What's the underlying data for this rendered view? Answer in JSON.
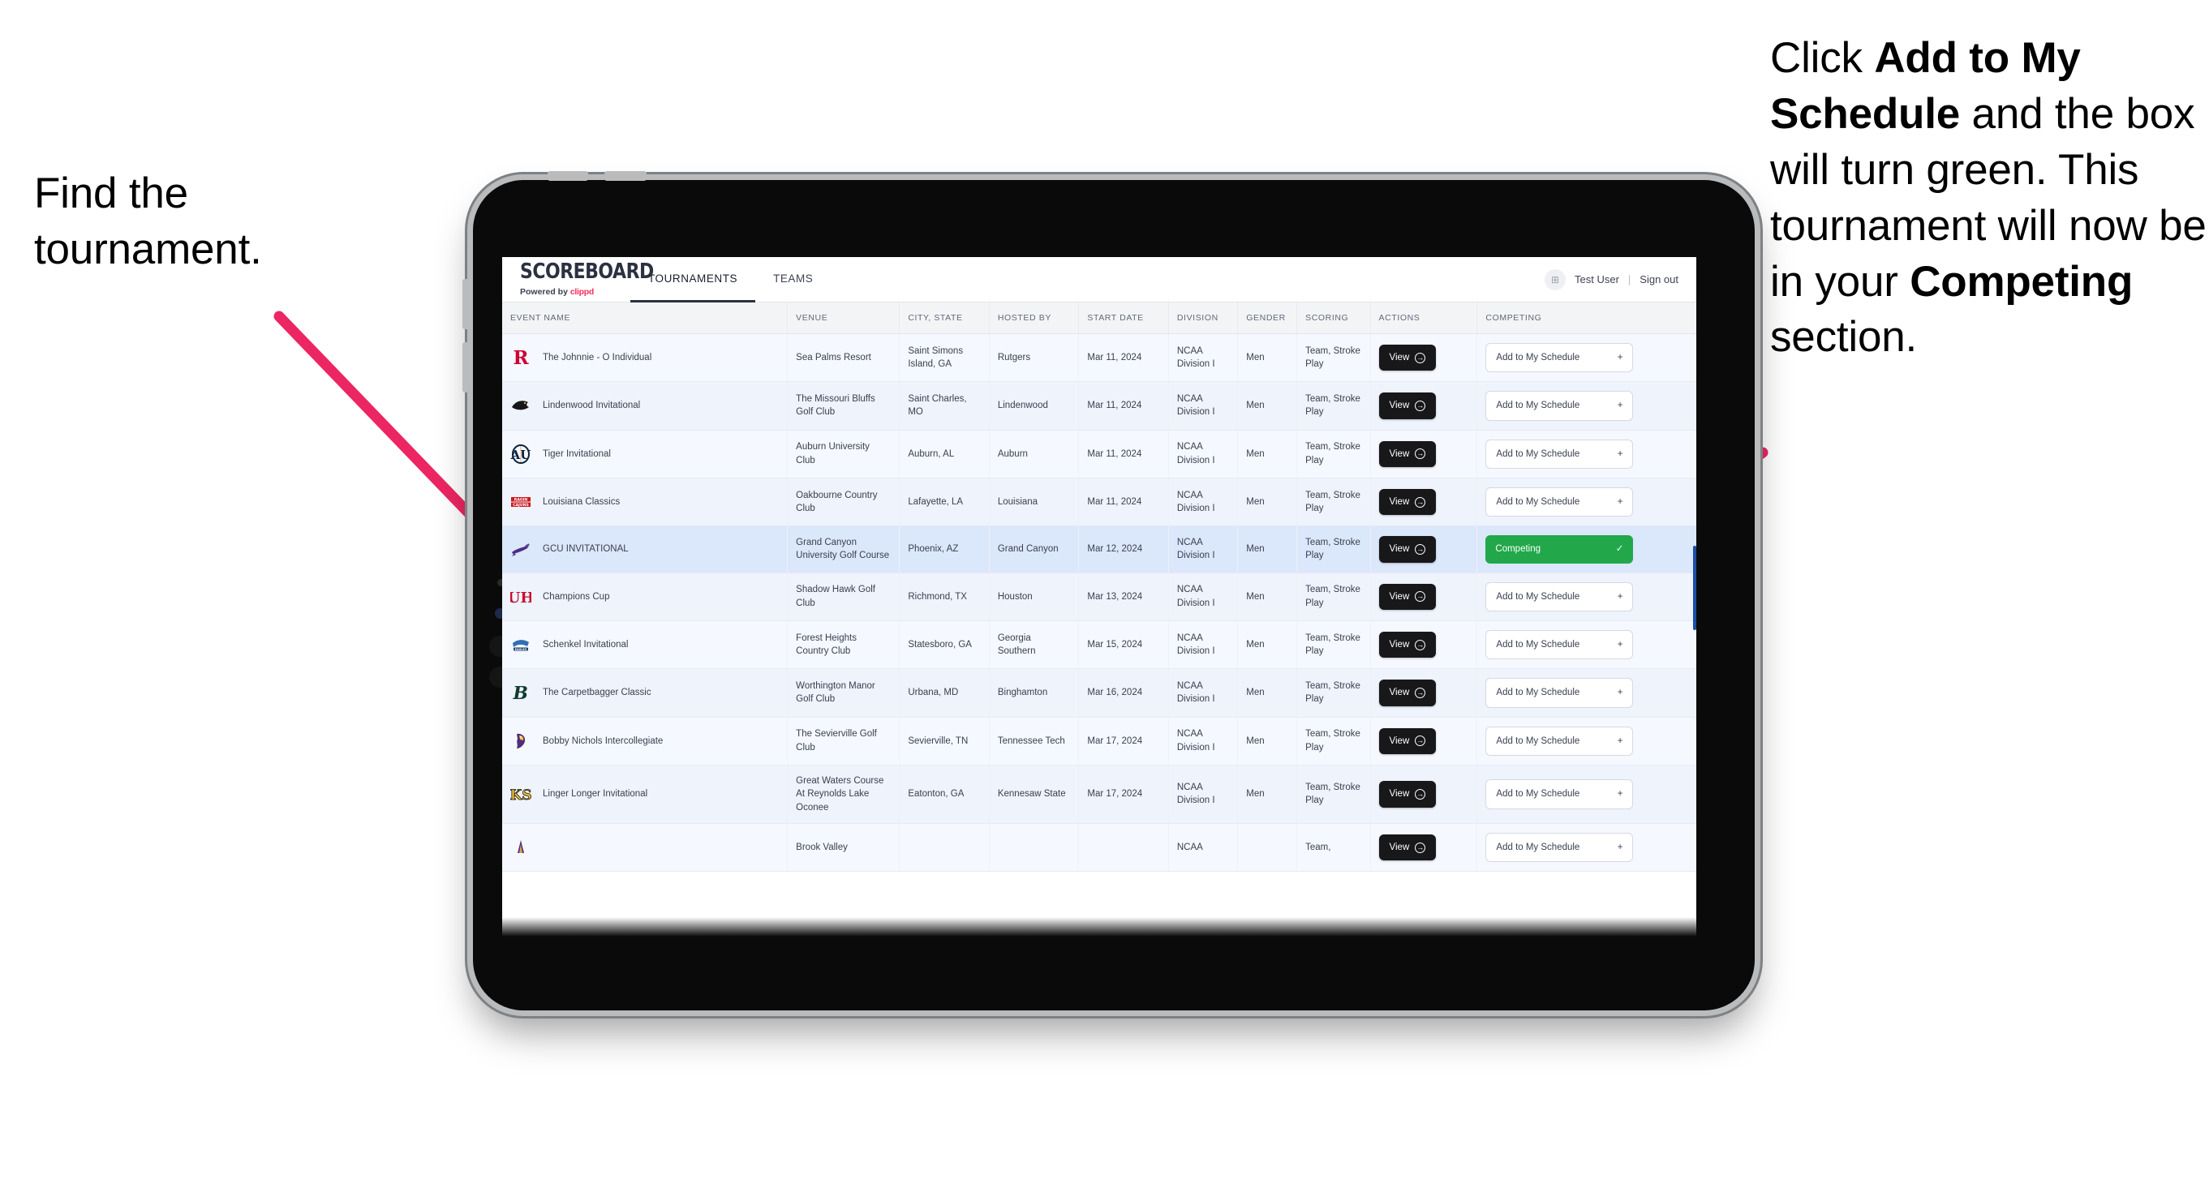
{
  "annotations": {
    "left": "Find the tournament.",
    "right_parts": [
      {
        "text": "Click ",
        "bold": false
      },
      {
        "text": "Add to My Schedule",
        "bold": true
      },
      {
        "text": " and the box will turn green. This tournament will now be in your ",
        "bold": false
      },
      {
        "text": "Competing",
        "bold": true
      },
      {
        "text": " section.",
        "bold": false
      }
    ],
    "arrow_color": "#ec2663"
  },
  "app": {
    "brand": {
      "wordmark": "SCOREBOARD",
      "powered_prefix": "Powered by ",
      "powered_brand": "clippd"
    },
    "tabs": [
      {
        "label": "TOURNAMENTS",
        "active": true
      },
      {
        "label": "TEAMS",
        "active": false
      }
    ],
    "user": {
      "name": "Test User",
      "separator": "|",
      "sign_out": "Sign out",
      "avatar_glyph": "⊞"
    },
    "table": {
      "columns": [
        "EVENT NAME",
        "VENUE",
        "CITY, STATE",
        "HOSTED BY",
        "START DATE",
        "DIVISION",
        "GENDER",
        "SCORING",
        "ACTIONS",
        "COMPETING"
      ],
      "view_label": "View",
      "add_label": "Add to My Schedule",
      "add_glyph": "+",
      "competing_label": "Competing",
      "competing_glyph": "✓",
      "competing_color": "#22a84a",
      "rows": [
        {
          "event": "The Johnnie - O Individual",
          "venue": "Sea Palms Resort",
          "city": "Saint Simons Island, GA",
          "host": "Rutgers",
          "date": "Mar 11, 2024",
          "division": "NCAA Division I",
          "gender": "Men",
          "scoring": "Team, Stroke Play",
          "competing": false,
          "logo": "rutgers-r-logo"
        },
        {
          "event": "Lindenwood Invitational",
          "venue": "The Missouri Bluffs Golf Club",
          "city": "Saint Charles, MO",
          "host": "Lindenwood",
          "date": "Mar 11, 2024",
          "division": "NCAA Division I",
          "gender": "Men",
          "scoring": "Team, Stroke Play",
          "competing": false,
          "logo": "lindenwood-lion-logo"
        },
        {
          "event": "Tiger Invitational",
          "venue": "Auburn University Club",
          "city": "Auburn, AL",
          "host": "Auburn",
          "date": "Mar 11, 2024",
          "division": "NCAA Division I",
          "gender": "Men",
          "scoring": "Team, Stroke Play",
          "competing": false,
          "logo": "auburn-au-logo"
        },
        {
          "event": "Louisiana Classics",
          "venue": "Oakbourne Country Club",
          "city": "Lafayette, LA",
          "host": "Louisiana",
          "date": "Mar 11, 2024",
          "division": "NCAA Division I",
          "gender": "Men",
          "scoring": "Team, Stroke Play",
          "competing": false,
          "logo": "ragin-cajuns-logo"
        },
        {
          "event": "GCU INVITATIONAL",
          "venue": "Grand Canyon University Golf Course",
          "city": "Phoenix, AZ",
          "host": "Grand Canyon",
          "date": "Mar 12, 2024",
          "division": "NCAA Division I",
          "gender": "Men",
          "scoring": "Team, Stroke Play",
          "competing": true,
          "logo": "gcu-lope-logo"
        },
        {
          "event": "Champions Cup",
          "venue": "Shadow Hawk Golf Club",
          "city": "Richmond, TX",
          "host": "Houston",
          "date": "Mar 13, 2024",
          "division": "NCAA Division I",
          "gender": "Men",
          "scoring": "Team, Stroke Play",
          "competing": false,
          "logo": "houston-uh-logo"
        },
        {
          "event": "Schenkel Invitational",
          "venue": "Forest Heights Country Club",
          "city": "Statesboro, GA",
          "host": "Georgia Southern",
          "date": "Mar 15, 2024",
          "division": "NCAA Division I",
          "gender": "Men",
          "scoring": "Team, Stroke Play",
          "competing": false,
          "logo": "georgia-southern-eagle-logo"
        },
        {
          "event": "The Carpetbagger Classic",
          "venue": "Worthington Manor Golf Club",
          "city": "Urbana, MD",
          "host": "Binghamton",
          "date": "Mar 16, 2024",
          "division": "NCAA Division I",
          "gender": "Men",
          "scoring": "Team, Stroke Play",
          "competing": false,
          "logo": "binghamton-b-logo"
        },
        {
          "event": "Bobby Nichols Intercollegiate",
          "venue": "The Sevierville Golf Club",
          "city": "Sevierville, TN",
          "host": "Tennessee Tech",
          "date": "Mar 17, 2024",
          "division": "NCAA Division I",
          "gender": "Men",
          "scoring": "Team, Stroke Play",
          "competing": false,
          "logo": "tennessee-tech-eagle-logo"
        },
        {
          "event": "Linger Longer Invitational",
          "venue": "Great Waters Course At Reynolds Lake Oconee",
          "city": "Eatonton, GA",
          "host": "Kennesaw State",
          "date": "Mar 17, 2024",
          "division": "NCAA Division I",
          "gender": "Men",
          "scoring": "Team, Stroke Play",
          "competing": false,
          "logo": "kennesaw-state-ksu-logo"
        },
        {
          "event": "",
          "venue": "Brook Valley",
          "city": "",
          "host": "",
          "date": "",
          "division": "NCAA",
          "gender": "",
          "scoring": "Team,",
          "competing": false,
          "logo": "partial-row-logo"
        }
      ]
    }
  }
}
